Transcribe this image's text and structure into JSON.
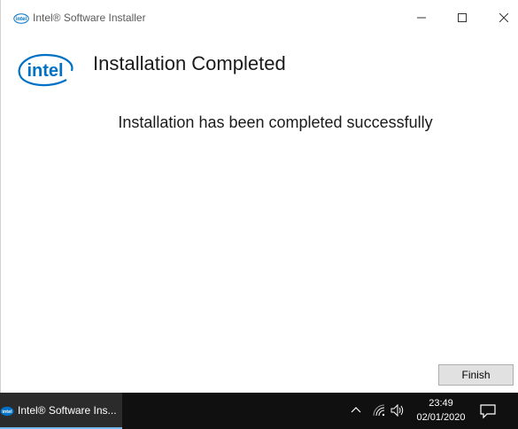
{
  "window": {
    "title": "Intel® Software Installer",
    "heading": "Installation Completed",
    "message": "Installation has been completed successfully",
    "finish_label": "Finish",
    "logo_text": "intel"
  },
  "taskbar": {
    "app_label": "Intel® Software Ins...",
    "time": "23:49",
    "date": "02/01/2020"
  },
  "icons": {
    "app": "intel-logo-icon",
    "minimize": "minimize-icon",
    "maximize": "maximize-icon",
    "close": "close-icon",
    "tray_chevron": "chevron-up-icon",
    "network": "wifi-icon",
    "volume": "speaker-icon",
    "notifications": "notification-icon"
  },
  "colors": {
    "intel_blue": "#0071c5",
    "taskbar": "#101010",
    "active_task_indicator": "#76b9ed"
  }
}
